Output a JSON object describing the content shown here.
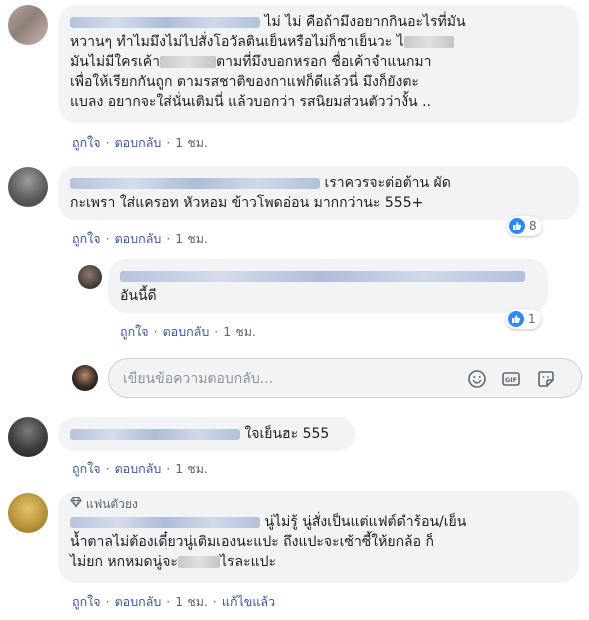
{
  "comments": [
    {
      "text_lines": [
        "ไม่ ไม่ คือถ้ามึงอยากกินอะไรที่มัน",
        "หวานๆ ทำไมมึงไม่ไปสั่งโอวัลตินเย็นหรือไม่ก็ชาเย็นวะ ไ",
        "มันไม่มีใครเค้า",
        "ตามที่มึงบอกหรอก ชื่อเค้าจำแนกมา",
        "เพื่อให้เรียกกันถูก ตามรสชาติของกาแฟก็ดีแล้วนี่ มึงก็ยังตะ",
        "แบลง อยากจะใส่นั่นเติมนี่ แล้วบอกว่า รสนิยมส่วนตัวว่างั้น .."
      ],
      "like_label": "ถูกใจ",
      "reply_label": "ตอบกลับ",
      "time": "1 ชม."
    },
    {
      "text_lines": [
        "เราควรจะต่อต้าน ผัด",
        "กะเพรา ใส่แครอท หัวหอม ข้าวโพดอ่อน มากกว่านะ 555+"
      ],
      "like_label": "ถูกใจ",
      "reply_label": "ตอบกลับ",
      "time": "1 ชม.",
      "reactions": "8"
    },
    {
      "text_lines": [
        "อันนี้ดี"
      ],
      "like_label": "ถูกใจ",
      "reply_label": "ตอบกลับ",
      "time": "1 ชม.",
      "reactions": "1"
    },
    {
      "text_lines": [
        "ใจเย็นฮะ 555"
      ],
      "like_label": "ถูกใจ",
      "reply_label": "ตอบกลับ",
      "time": "1 ชม."
    },
    {
      "badge": "แฟนตัวยง",
      "text_lines": [
        "นู่ไม่รู้ นู่สั่งเป็นแต่แฟต์ดำร้อน/เย็น",
        "น้ำตาลไม่ต้องเดี๋ยวนู่เติมเองนะแปะ ถึงแปะจะเซ้าซี้ให้ยกล้อ ก็",
        "ไม่ยก หกหมดนู่จะ",
        "ไรละแปะ"
      ],
      "like_label": "ถูกใจ",
      "reply_label": "ตอบกลับ",
      "time": "1 ชม.",
      "edited_label": "แก้ไขแล้ว"
    }
  ],
  "reply_box": {
    "placeholder": "เขียนข้อความตอบกลับ...",
    "icons": [
      "emoji-icon",
      "gif-icon",
      "sticker-icon"
    ]
  },
  "colors": {
    "link": "#385898",
    "bubble": "#f2f3f5",
    "like_blue": "#2d88ff",
    "meta": "#606770"
  }
}
